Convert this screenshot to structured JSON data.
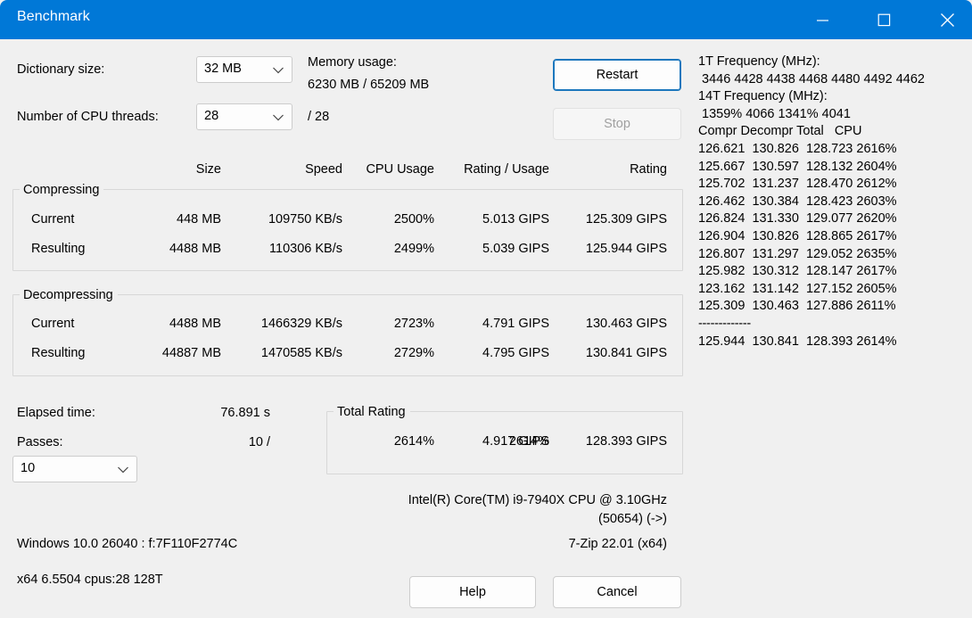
{
  "window": {
    "title": "Benchmark",
    "accent_color": "#0078d7",
    "background_color": "#f0f0f0",
    "controls": {
      "minimize": "minimize-icon",
      "maximize": "maximize-icon",
      "close": "close-icon"
    }
  },
  "settings": {
    "dictionary_label": "Dictionary size:",
    "dictionary_value": "32 MB",
    "threads_label": "Number of CPU threads:",
    "threads_value": "28",
    "threads_total": "/ 28",
    "memory_label": "Memory usage:",
    "memory_value": "6230 MB / 65209 MB",
    "restart_label": "Restart",
    "stop_label": "Stop",
    "chevron_icon": "chevron-down-icon"
  },
  "table": {
    "headers": [
      "Size",
      "Speed",
      "CPU Usage",
      "Rating / Usage",
      "Rating"
    ],
    "groups": [
      {
        "title": "Compressing",
        "rows": [
          {
            "name": "Current",
            "size": "448 MB",
            "speed": "109750 KB/s",
            "cpu": "2500%",
            "rating_usage": "5.013 GIPS",
            "rating": "125.309 GIPS"
          },
          {
            "name": "Resulting",
            "size": "4488 MB",
            "speed": "110306 KB/s",
            "cpu": "2499%",
            "rating_usage": "5.039 GIPS",
            "rating": "125.944 GIPS"
          }
        ]
      },
      {
        "title": "Decompressing",
        "rows": [
          {
            "name": "Current",
            "size": "4488 MB",
            "speed": "1466329 KB/s",
            "cpu": "2723%",
            "rating_usage": "4.791 GIPS",
            "rating": "130.463 GIPS"
          },
          {
            "name": "Resulting",
            "size": "44887 MB",
            "speed": "1470585 KB/s",
            "cpu": "2729%",
            "rating_usage": "4.795 GIPS",
            "rating": "130.841 GIPS"
          }
        ]
      }
    ]
  },
  "summary": {
    "elapsed_label": "Elapsed time:",
    "elapsed_value": "76.891 s",
    "passes_label": "Passes:",
    "passes_value": "10 /",
    "passes_select_value": "10",
    "total_rating_title": "Total Rating",
    "total_cpu": "2614%",
    "total_rating_usage": "4.917 GIPS",
    "total_rating": "128.393 GIPS"
  },
  "footer": {
    "cpu_name": "Intel(R) Core(TM) i9-7940X CPU @ 3.10GHz",
    "cpu_id": "(50654) (->)",
    "os_info": "Windows 10.0 26040 :  f:7F110F2774C",
    "app_version": "7-Zip 22.01 (x64)",
    "arch_info": "x64 6.5504 cpus:28 128T",
    "help_label": "Help",
    "cancel_label": "Cancel"
  },
  "log": {
    "freq1_label": "1T Frequency (MHz):",
    "freq1_values": " 3446 4428 4438 4468 4480 4492 4462",
    "freq14_label": "14T Frequency (MHz):",
    "freq14_values": " 1359% 4066 1341% 4041",
    "columns": "Compr Decompr Total   CPU",
    "rows": [
      "126.621  130.826  128.723 2616%",
      "125.667  130.597  128.132 2604%",
      "125.702  131.237  128.470 2612%",
      "126.462  130.384  128.423 2603%",
      "126.824  131.330  129.077 2620%",
      "126.904  130.826  128.865 2617%",
      "126.807  131.297  129.052 2635%",
      "125.982  130.312  128.147 2617%",
      "123.162  131.142  127.152 2605%",
      "125.309  130.463  127.886 2611%"
    ],
    "separator": "-------------",
    "total_row": "125.944  130.841  128.393 2614%"
  }
}
